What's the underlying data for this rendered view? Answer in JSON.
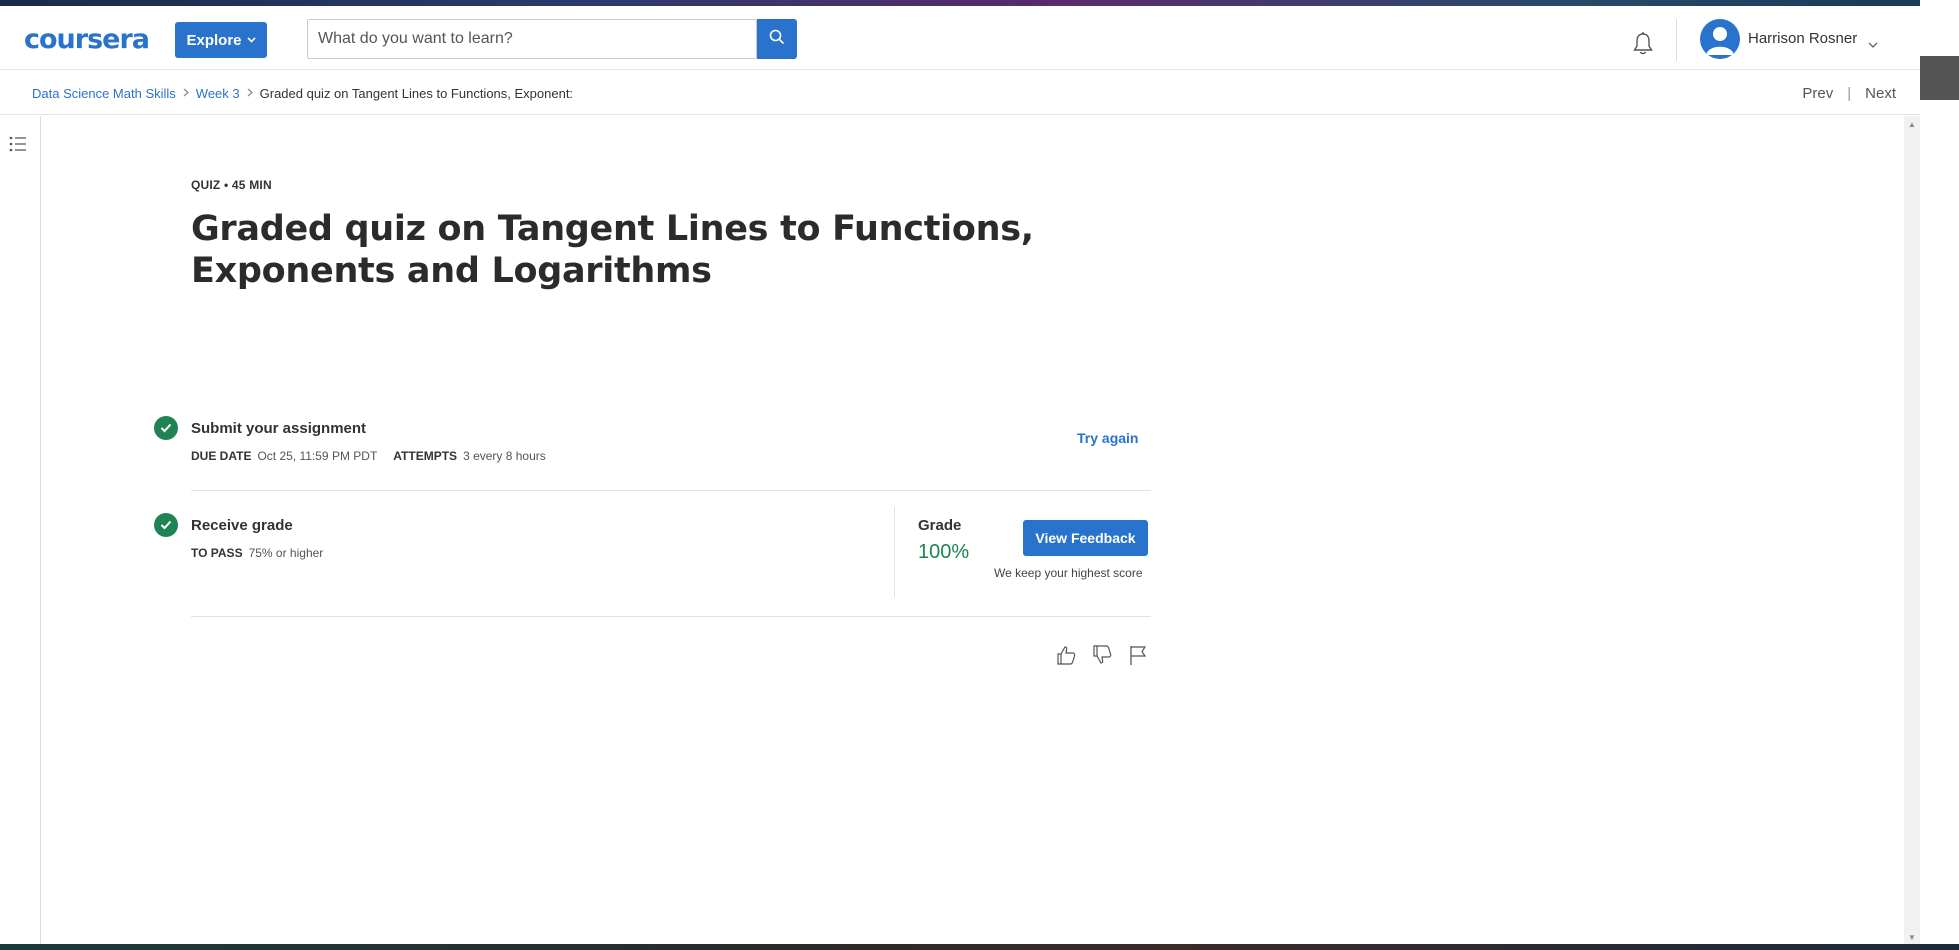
{
  "header": {
    "logo": "coursera",
    "explore_label": "Explore",
    "search_placeholder": "What do you want to learn?",
    "user_name": "Harrison Rosner"
  },
  "breadcrumb": {
    "items": [
      "Data Science Math Skills",
      "Week 3",
      "Graded quiz on Tangent Lines to Functions, Exponent:"
    ],
    "prev": "Prev",
    "next": "Next"
  },
  "quiz": {
    "meta": "QUIZ • 45 MIN",
    "title": "Graded quiz on Tangent Lines to Functions, Exponents and Logarithms"
  },
  "submit": {
    "title": "Submit your assignment",
    "due_label": "DUE DATE",
    "due_value": "Oct 25, 11:59 PM PDT",
    "attempts_label": "ATTEMPTS",
    "attempts_value": "3 every 8 hours",
    "try_again": "Try again"
  },
  "receive": {
    "title": "Receive grade",
    "pass_label": "TO PASS",
    "pass_value": "75% or higher",
    "grade_label": "Grade",
    "grade_value": "100%",
    "view_feedback": "View Feedback",
    "keep_score": "We keep your highest score"
  },
  "colors": {
    "brand": "#2a73cc",
    "success": "#1f8354"
  },
  "icons": [
    "search-icon",
    "bell-icon",
    "avatar-icon",
    "chevron-down-icon",
    "list-icon",
    "check-icon",
    "thumbs-up-icon",
    "thumbs-down-icon",
    "flag-icon"
  ]
}
